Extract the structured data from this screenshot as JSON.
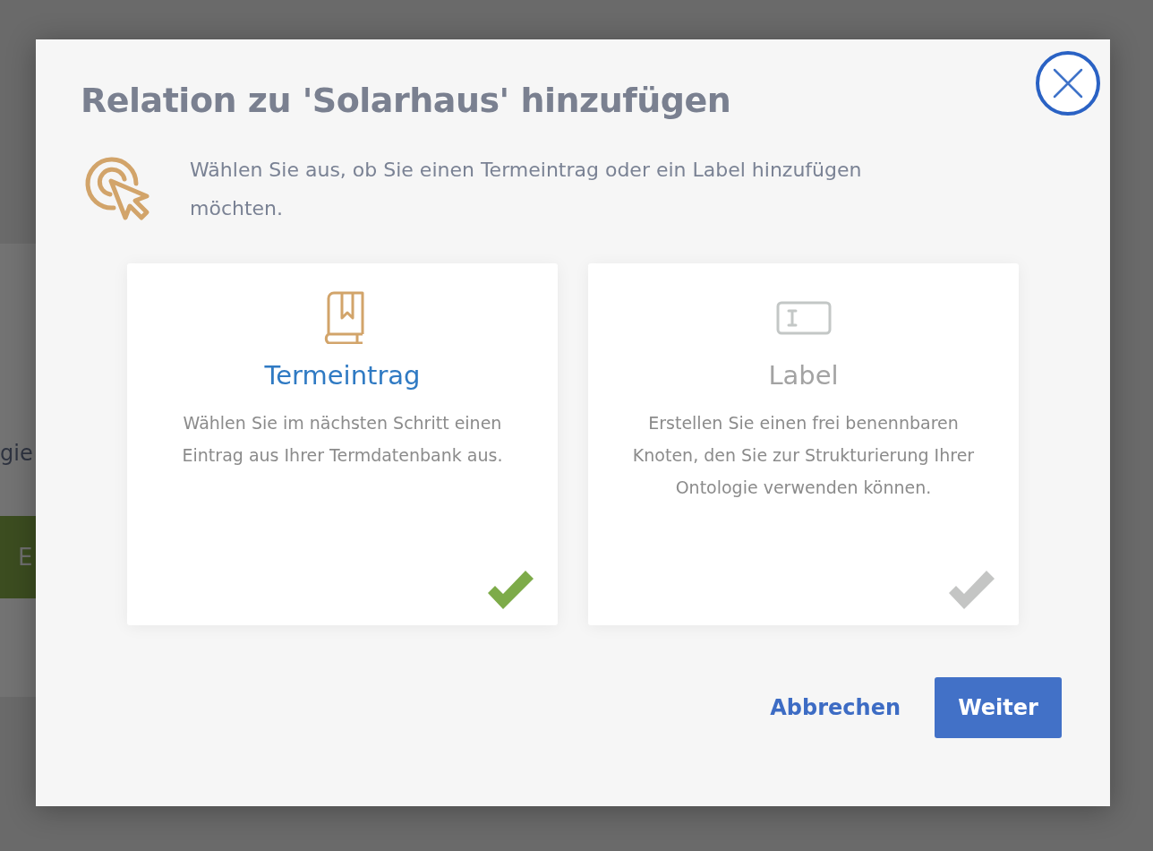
{
  "background": {
    "text": "gie",
    "button": "E"
  },
  "dialog": {
    "title": "Relation zu 'Solarhaus' hinzufügen",
    "intro": "Wählen Sie aus, ob Sie einen Termeintrag oder ein Label hinzufügen möchten.",
    "options": [
      {
        "kind": "term",
        "title": "Termeintrag",
        "description": "Wählen Sie im nächsten Schritt einen Eintrag aus Ihrer Termdatenbank aus.",
        "selected": true
      },
      {
        "kind": "label",
        "title": "Label",
        "description": "Erstellen Sie einen frei benennbaren Knoten, den Sie zur Strukturierung Ihrer Ontologie verwenden können.",
        "selected": false
      }
    ],
    "buttons": {
      "cancel": "Abbrechen",
      "next": "Weiter"
    }
  }
}
